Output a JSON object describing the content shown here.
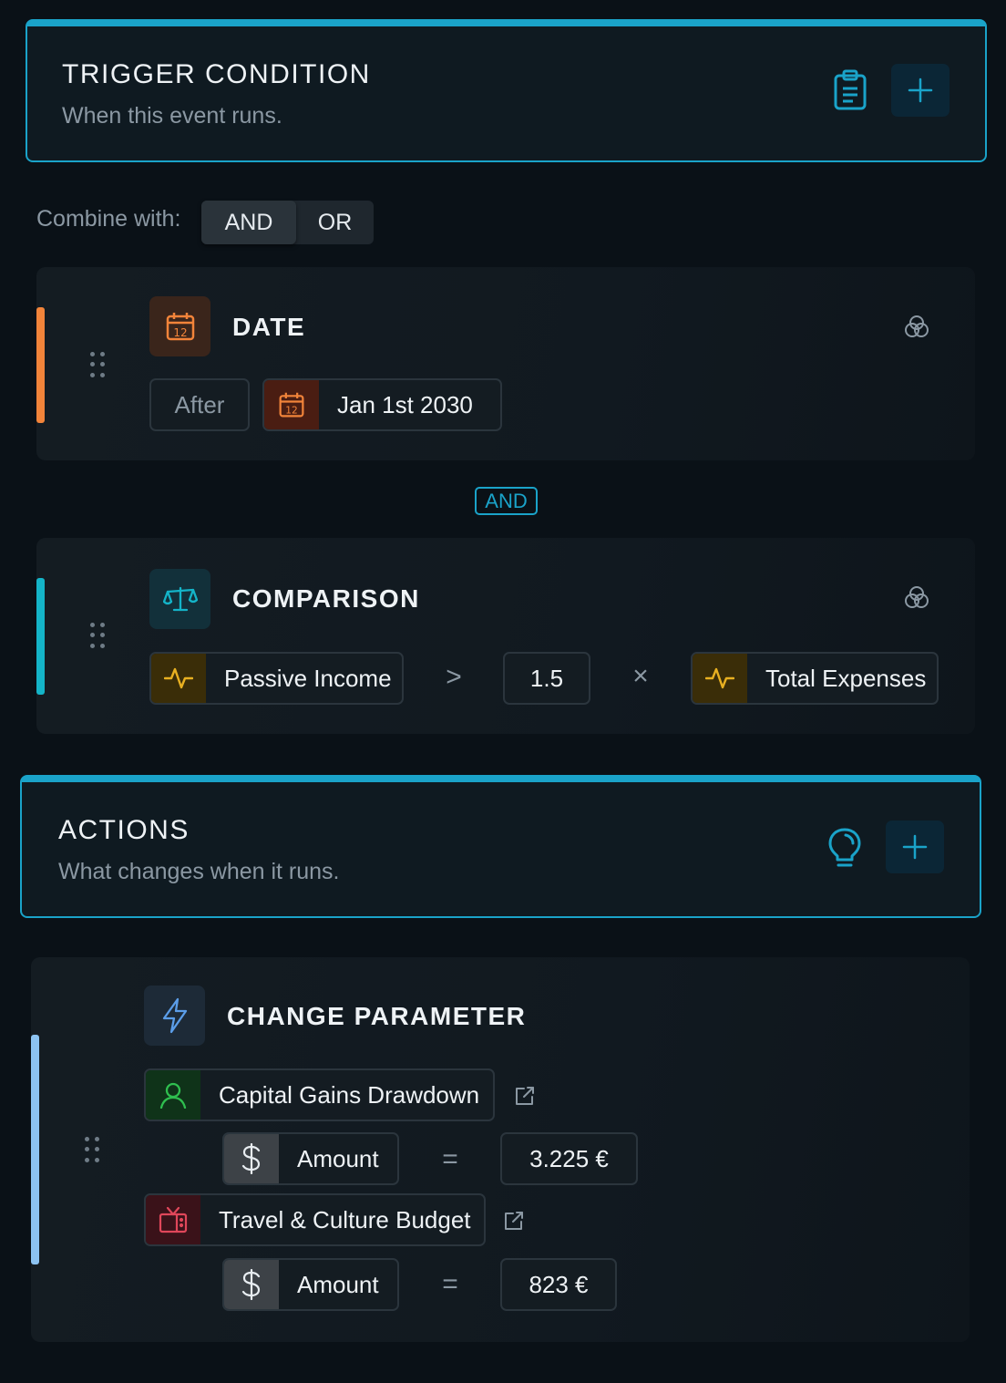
{
  "trigger": {
    "title": "TRIGGER CONDITION",
    "subtitle": "When this event runs.",
    "icon": "clipboard-icon",
    "add_icon": "plus-icon"
  },
  "combine": {
    "label": "Combine with:",
    "options": [
      "AND",
      "OR"
    ],
    "selected": "AND"
  },
  "conditions": [
    {
      "title": "DATE",
      "icon": "calendar-icon",
      "accent": "#f2843a",
      "operator_label": "After",
      "value_icon": "calendar-icon",
      "value": "Jan 1st 2030",
      "calendar_day": "12"
    },
    {
      "title": "COMPARISON",
      "icon": "scale-icon",
      "accent": "#14b4c8",
      "left_label": "Passive Income",
      "left_icon": "activity-icon",
      "comparator": ">",
      "multiplier": "1.5",
      "times": "×",
      "right_label": "Total Expenses",
      "right_icon": "activity-icon"
    }
  ],
  "connector": "AND",
  "actions_header": {
    "title": "ACTIONS",
    "subtitle": "What changes when it runs.",
    "icon": "lightbulb-icon",
    "add_icon": "plus-icon"
  },
  "action": {
    "title": "CHANGE PARAMETER",
    "icon": "lightning-icon",
    "accent": "#8cc3f2",
    "items": [
      {
        "target": "Capital Gains Drawdown",
        "target_icon": "user-icon",
        "param": "Amount",
        "param_icon": "dollar-icon",
        "equals": "=",
        "value": "3.225 €"
      },
      {
        "target": "Travel & Culture Budget",
        "target_icon": "tv-icon",
        "param": "Amount",
        "param_icon": "dollar-icon",
        "equals": "=",
        "value": "823 €"
      }
    ]
  },
  "colors": {
    "accent_blue": "#1aa3c9",
    "date_orange": "#f2843a",
    "comparison_teal": "#14b4c8",
    "action_blue": "#8cc3f2",
    "activity_yellow": "#e8b021",
    "user_green": "#2fbf4f",
    "tv_red": "#e0475a"
  }
}
